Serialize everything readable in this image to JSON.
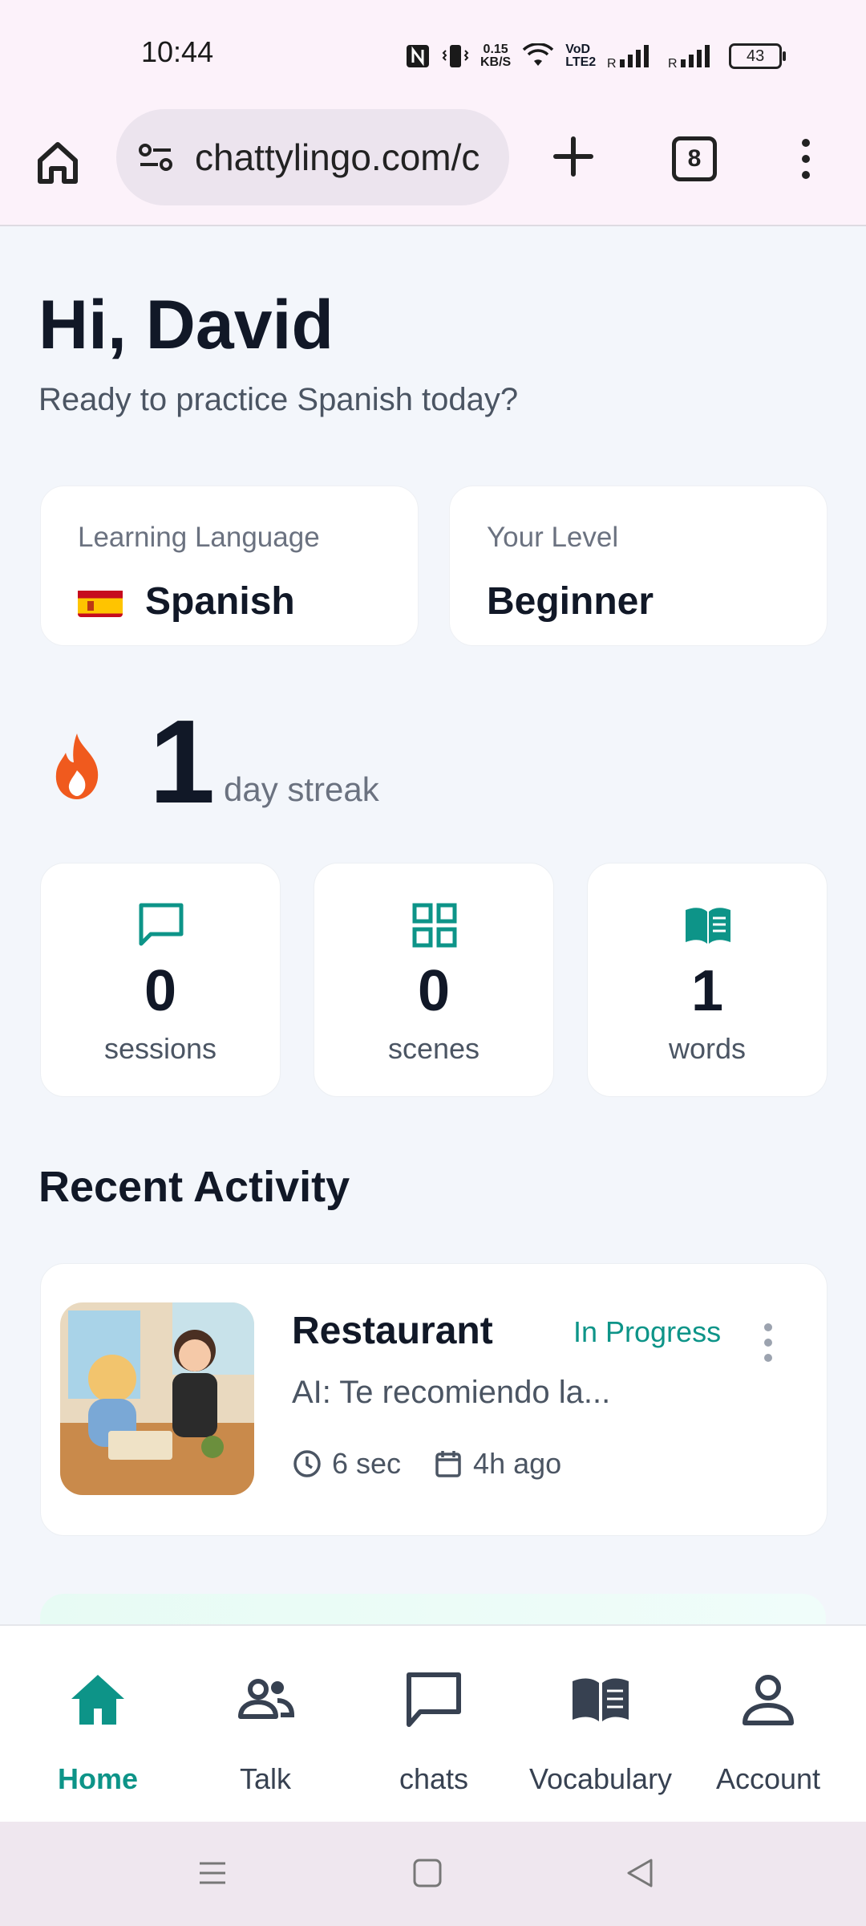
{
  "status_bar": {
    "time": "10:44",
    "net_speed_value": "0.15",
    "net_speed_unit": "KB/S",
    "volte_label_top": "VoD",
    "volte_label_bottom": "LTE2",
    "battery": "43",
    "icons": [
      "nfc-icon",
      "vibrate-icon",
      "wifi-icon",
      "volte-icon",
      "signal-icon",
      "signal-icon",
      "battery-icon"
    ]
  },
  "browser": {
    "url": "chattylingo.com/c",
    "tab_count": "8",
    "icons": [
      "home-icon",
      "site-info-icon",
      "plus-icon",
      "tabs-icon",
      "more-vert-icon"
    ]
  },
  "greeting": {
    "title": "Hi, David",
    "subtitle": "Ready to practice Spanish today?"
  },
  "language_card": {
    "label": "Learning Language",
    "value": "Spanish",
    "flag": "spain-flag"
  },
  "level_card": {
    "label": "Your Level",
    "value": "Beginner"
  },
  "streak": {
    "number": "1",
    "label": "day streak",
    "icon": "flame-icon",
    "color": "#f05a1e"
  },
  "stats": [
    {
      "value": "0",
      "unit": "sessions",
      "icon": "chat-bubble-icon"
    },
    {
      "value": "0",
      "unit": "scenes",
      "icon": "grid-icon"
    },
    {
      "value": "1",
      "unit": "words",
      "icon": "book-icon"
    }
  ],
  "recent": {
    "title": "Recent Activity",
    "items": [
      {
        "title": "Restaurant",
        "status": "In Progress",
        "preview": "AI: Te recomiendo la...",
        "duration": "6 sec",
        "time_ago": "4h ago"
      }
    ]
  },
  "nav": {
    "items": [
      {
        "label": "Home",
        "icon": "home-icon",
        "active": true
      },
      {
        "label": "Talk",
        "icon": "people-icon"
      },
      {
        "label": "chats",
        "icon": "chat-icon"
      },
      {
        "label": "Vocabulary",
        "icon": "book-icon"
      },
      {
        "label": "Account",
        "icon": "person-icon"
      }
    ]
  },
  "colors": {
    "accent": "#0d9488",
    "text": "#111827",
    "muted": "#6b7280",
    "background": "#f3f6fb"
  }
}
